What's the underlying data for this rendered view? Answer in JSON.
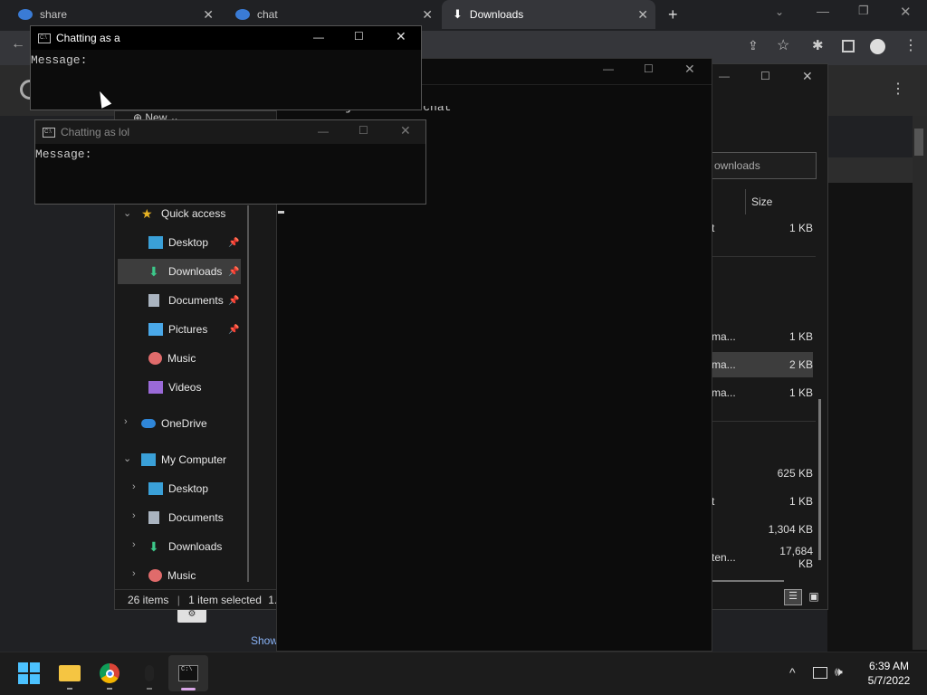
{
  "browser": {
    "tabs": [
      {
        "label": "share"
      },
      {
        "label": "chat"
      },
      {
        "label": "Downloads"
      }
    ],
    "new_tab": "+",
    "menu_dots": "⋮"
  },
  "cmd_windows": [
    {
      "title": "Chatting as a",
      "prompt": "Message:"
    },
    {
      "title": "Chatting as lol",
      "prompt": "Message:"
    }
  ],
  "terminal": {
    "partial_text": "as joined the chat"
  },
  "explorer": {
    "new_label": "New",
    "quick_access": "Quick access",
    "quick_items": [
      {
        "label": "Desktop"
      },
      {
        "label": "Downloads"
      },
      {
        "label": "Documents"
      },
      {
        "label": "Pictures"
      },
      {
        "label": "Music"
      },
      {
        "label": "Videos"
      }
    ],
    "onedrive": "OneDrive",
    "my_computer": "My Computer",
    "computer_items": [
      {
        "label": "Desktop"
      },
      {
        "label": "Documents"
      },
      {
        "label": "Downloads"
      },
      {
        "label": "Music"
      }
    ],
    "status_items": "26 items",
    "status_selected": "1 item selected",
    "status_size": "1.6",
    "search_placeholder": "ownloads",
    "col_size": "Size",
    "rows": [
      {
        "name": "t",
        "size": "1 KB"
      },
      {
        "name": "ma...",
        "size": "1 KB"
      },
      {
        "name": "ma...",
        "size": "2 KB"
      },
      {
        "name": "ma...",
        "size": "1 KB"
      },
      {
        "name": "",
        "size": "625 KB"
      },
      {
        "name": "t",
        "size": "1 KB"
      },
      {
        "name": "",
        "size": "1,304 KB"
      },
      {
        "name": "ten...",
        "size": "17,684 KB"
      }
    ]
  },
  "chrome_page": {
    "show_label": "Show"
  },
  "taskbar": {
    "time": "6:39 AM",
    "date": "5/7/2022"
  },
  "colors": {
    "selected_row": "#3d3d3d",
    "cmd_bg": "#0c0c0c",
    "taskbar_bg": "#1c1c1c"
  }
}
